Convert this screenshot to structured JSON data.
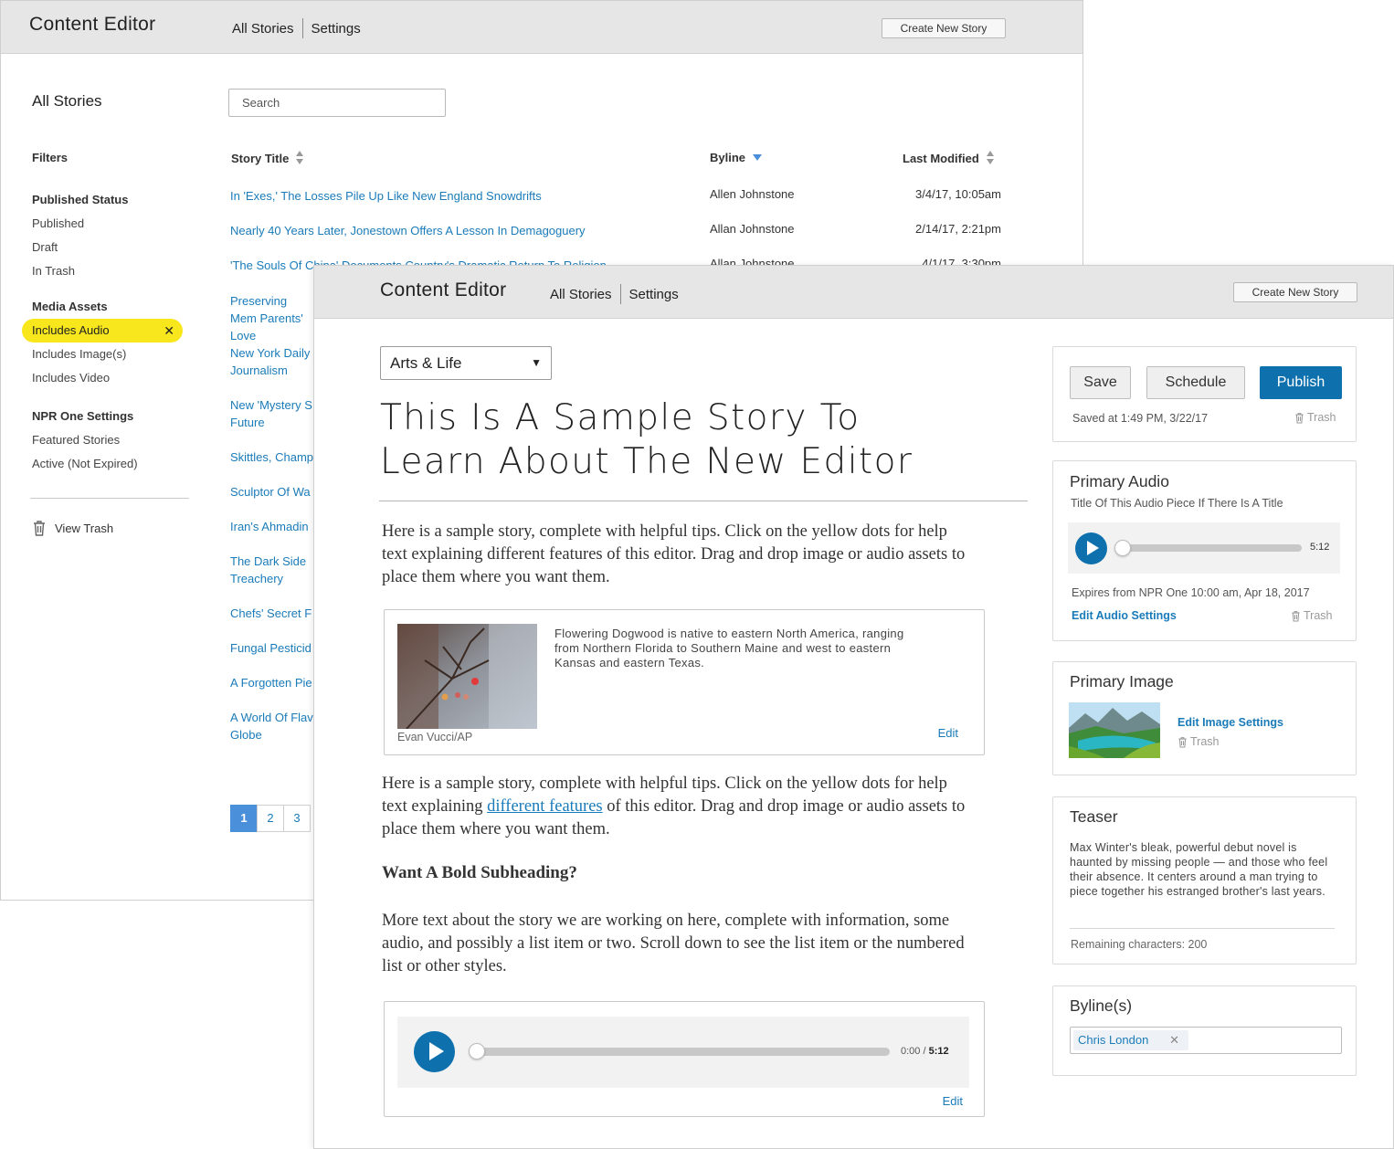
{
  "back_window": {
    "app_title": "Content Editor",
    "nav": [
      "All Stories",
      "Settings"
    ],
    "create_button": "Create New Story",
    "sidebar": {
      "heading": "All Stories",
      "filters_label": "Filters",
      "groups": [
        {
          "title": "Published Status",
          "items": [
            "Published",
            "Draft",
            "In Trash"
          ]
        },
        {
          "title": "Media Assets",
          "items": [
            "Includes Audio",
            "Includes Image(s)",
            "Includes Video"
          ],
          "active_item": "Includes Audio"
        },
        {
          "title": "NPR One Settings",
          "items": [
            "Featured Stories",
            "Active (Not Expired)"
          ]
        }
      ],
      "view_trash": "View Trash"
    },
    "search_placeholder": "Search",
    "columns": {
      "title": "Story Title",
      "byline": "Byline",
      "modified": "Last Modified"
    },
    "stories": [
      {
        "title": "In 'Exes,' The Losses Pile Up Like New England Snowdrifts",
        "byline": "Allen Johnstone",
        "date": "3/4/17, 10:05am"
      },
      {
        "title": "Nearly 40 Years Later, Jonestown Offers A Lesson In Demagoguery",
        "byline": "Allan Johnstone",
        "date": "2/14/17, 2:21pm"
      },
      {
        "title": "'The Souls Of China' Documents Country's Dramatic Return To Religion",
        "byline": "Allan Johnstone",
        "date": "4/1/17, 3:30pm"
      },
      {
        "title": "Preserving Mem Parents' Love",
        "byline": "",
        "date": ""
      },
      {
        "title": "New York Daily Journalism",
        "byline": "",
        "date": ""
      },
      {
        "title": "New 'Mystery S Future",
        "byline": "",
        "date": ""
      },
      {
        "title": "Skittles, Champ",
        "byline": "",
        "date": ""
      },
      {
        "title": "Sculptor Of Wa",
        "byline": "",
        "date": ""
      },
      {
        "title": "Iran's Ahmadin",
        "byline": "",
        "date": ""
      },
      {
        "title": "The Dark Side Treachery",
        "byline": "",
        "date": ""
      },
      {
        "title": "Chefs' Secret F",
        "byline": "",
        "date": ""
      },
      {
        "title": "Fungal Pesticid",
        "byline": "",
        "date": ""
      },
      {
        "title": "A Forgotten Pie",
        "byline": "",
        "date": ""
      },
      {
        "title": "A World Of Flav Globe",
        "byline": "",
        "date": ""
      }
    ],
    "pages": [
      "1",
      "2",
      "3"
    ],
    "current_page": "1"
  },
  "front_window": {
    "app_title": "Content Editor",
    "nav": [
      "All Stories",
      "Settings"
    ],
    "create_button": "Create New Story",
    "section": "Arts & Life",
    "headline": "This Is A Sample Story To Learn About The New Editor",
    "paragraph1": "Here is a sample story, complete with helpful tips. Click on the yellow dots for help text explaining different features of this editor. Drag and drop image or audio assets to place them where you want them.",
    "paragraph2": {
      "before": "Here is a sample story, complete with helpful tips. Click on the yellow dots for help text explaining ",
      "link": "different features",
      "after": " of this editor. Drag and drop image or audio assets to place them where you want them."
    },
    "subheading": "Want A Bold Subheading?",
    "paragraph3": "More text about the story we are working on here, complete with information, some audio, and possibly a list item or two. Scroll down to see the list item or the numbered list or other styles.",
    "image_asset": {
      "caption": "Flowering Dogwood is native to eastern North America, ranging from Northern Florida to Southern Maine and west to eastern Kansas and eastern Texas.",
      "credit": "Evan Vucci/AP",
      "edit": "Edit"
    },
    "audio_asset": {
      "elapsed": "0:00",
      "total": "5:12",
      "edit": "Edit",
      "progress": 0
    },
    "actions": {
      "save": "Save",
      "schedule": "Schedule",
      "publish": "Publish",
      "saved_status": "Saved at 1:49 PM, 3/22/17",
      "trash": "Trash"
    },
    "primary_audio": {
      "title": "Primary Audio",
      "audio_title": "Title Of This Audio Piece If There Is A Title",
      "duration": "5:12",
      "progress": 0,
      "expires": "Expires from NPR One 10:00 am, Apr 18, 2017",
      "edit_link": "Edit Audio Settings",
      "trash": "Trash"
    },
    "primary_image": {
      "title": "Primary Image",
      "edit_link": "Edit Image Settings",
      "trash": "Trash"
    },
    "teaser": {
      "title": "Teaser",
      "text": "Max Winter's bleak, powerful debut novel is haunted by missing people — and those who feel their absence. It centers around a man trying to piece together his estranged brother's last years.",
      "remaining": "Remaining characters: 200"
    },
    "bylines": {
      "title": "Byline(s)",
      "tags": [
        "Chris London"
      ]
    }
  },
  "colors": {
    "link": "#1a7bb9",
    "primary": "#0e70ad",
    "highlight": "#f7e71c",
    "header_bg": "#e6e6e6"
  }
}
